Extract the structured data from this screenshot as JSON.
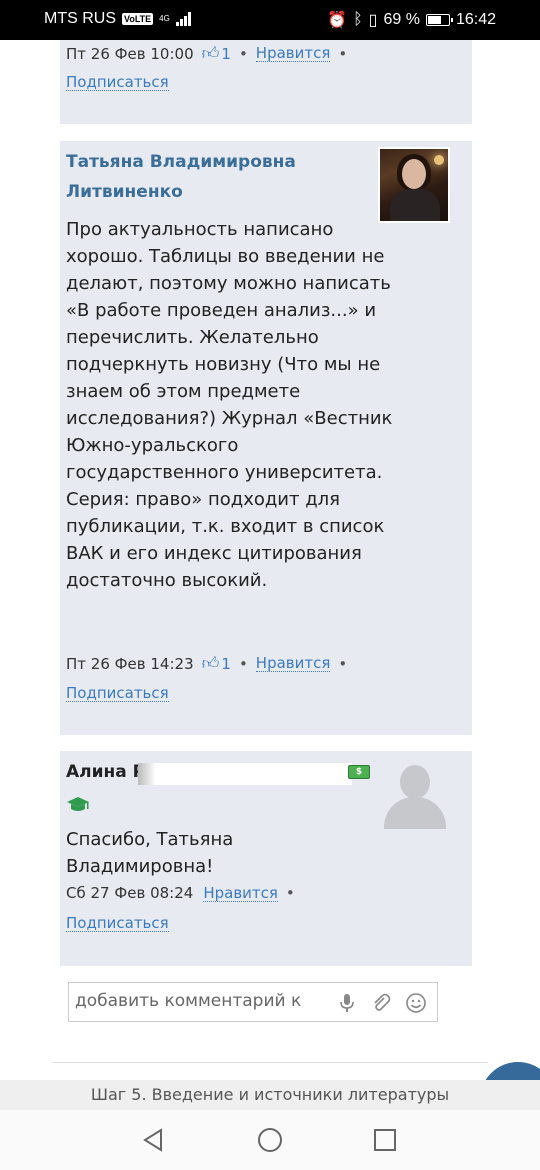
{
  "status_bar": {
    "carrier": "MTS RUS",
    "volte": "VoLTE",
    "network": "4G",
    "battery_percent": "69 %",
    "battery_level": 0.69,
    "time": "16:42"
  },
  "comments": [
    {
      "date": "Пт 26 Фев 10:00",
      "likes": "1",
      "like_label": "Нравится",
      "subscribe_label": "Подписаться"
    },
    {
      "author": "Татьяна Владимировна Литвиненко",
      "text": "Про актуальность написано хорошо.\nТаблицы во введении не делают, поэтому можно написать «В работе проведен анализ...» и перечислить.\nЖелательно подчеркнуть новизну (Что мы не знаем об этом предмете исследования?)\nЖурнал «Вестник Южно-уральского государственного университета. Серия: право» подходит для публикации, т.к. входит в список ВАК и его индекс цитирования достаточно высокий.",
      "date": "Пт 26 Фев 14:23",
      "likes": "1",
      "like_label": "Нравится",
      "subscribe_label": "Подписаться"
    },
    {
      "author": "Алина Р",
      "text": "Спасибо, Татьяна Владимировна!",
      "date": "Сб 27 Фев 08:24",
      "like_label": "Нравится",
      "subscribe_label": "Подписаться"
    }
  ],
  "comment_input": {
    "placeholder": "добавить комментарий к"
  },
  "footer": {
    "step_title": "Шаг 5. Введение и источники литературы"
  },
  "colors": {
    "accent": "#3b7bbf",
    "card_bg": "#e7eaf0",
    "author": "#3b6e99"
  }
}
